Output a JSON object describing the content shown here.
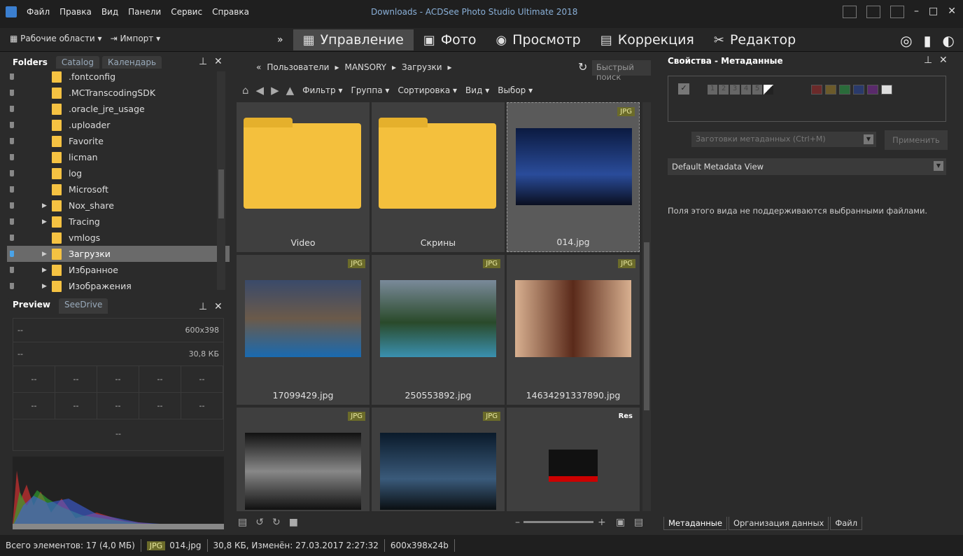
{
  "menu": [
    "Файл",
    "Правка",
    "Вид",
    "Панели",
    "Сервис",
    "Справка"
  ],
  "window_title": "Downloads - ACDSee Photo Studio Ultimate 2018",
  "modebar": {
    "workspaces": "Рабочие области",
    "import": "Импорт",
    "modes": [
      "Управление",
      "Фото",
      "Просмотр",
      "Коррекция",
      "Редактор"
    ],
    "active_mode": "Управление"
  },
  "left_tabs": [
    "Folders",
    "Catalog",
    "Календарь"
  ],
  "folders": [
    {
      "name": ".fontconfig",
      "expand": false,
      "selected": false
    },
    {
      "name": ".MCTranscodingSDK",
      "expand": false,
      "selected": false
    },
    {
      "name": ".oracle_jre_usage",
      "expand": false,
      "selected": false
    },
    {
      "name": ".uploader",
      "expand": false,
      "selected": false
    },
    {
      "name": "Favorite",
      "expand": false,
      "selected": false
    },
    {
      "name": "licman",
      "expand": false,
      "selected": false
    },
    {
      "name": "log",
      "expand": false,
      "selected": false
    },
    {
      "name": "Microsoft",
      "expand": false,
      "selected": false
    },
    {
      "name": "Nox_share",
      "expand": true,
      "selected": false
    },
    {
      "name": "Tracing",
      "expand": true,
      "selected": false
    },
    {
      "name": "vmlogs",
      "expand": false,
      "selected": false
    },
    {
      "name": "Загрузки",
      "expand": true,
      "selected": true
    },
    {
      "name": "Избранное",
      "expand": true,
      "selected": false
    },
    {
      "name": "Изображения",
      "expand": true,
      "selected": false
    }
  ],
  "preview_tabs": [
    "Preview",
    "SeeDrive"
  ],
  "preview": {
    "row1_left": "--",
    "row1_right": "600x398",
    "row2_left": "--",
    "row2_right": "30,8 КБ",
    "grid1": [
      "--",
      "--",
      "--",
      "--",
      "--"
    ],
    "grid2": [
      "--",
      "--",
      "--",
      "--",
      "--"
    ],
    "bottom": "--"
  },
  "path": [
    "«",
    "Пользователи",
    "MANSORY",
    "Загрузки"
  ],
  "quick_search": "Быстрый поиск",
  "toolbar": [
    "Фильтр",
    "Группа",
    "Сортировка",
    "Вид",
    "Выбор"
  ],
  "files": [
    {
      "name": "Video",
      "badge": "",
      "kind": "folder"
    },
    {
      "name": "Скрины",
      "badge": "",
      "kind": "folder2"
    },
    {
      "name": "014.jpg",
      "badge": "JPG",
      "kind": "night",
      "selected": true
    },
    {
      "name": "17099429.jpg",
      "badge": "JPG",
      "kind": "coast"
    },
    {
      "name": "250553892.jpg",
      "badge": "JPG",
      "kind": "forest"
    },
    {
      "name": "14634291337890.jpg",
      "badge": "JPG",
      "kind": "portrait"
    },
    {
      "name": "",
      "badge": "JPG",
      "kind": "meme"
    },
    {
      "name": "",
      "badge": "JPG",
      "kind": "road"
    },
    {
      "name": "",
      "badge": "Res",
      "kind": "res"
    }
  ],
  "right": {
    "title": "Свойства - Метаданные",
    "preset": "Заготовки метаданных (Ctrl+M)",
    "apply": "Применить",
    "view": "Default Metadata View",
    "notice": "Поля этого вида не поддерживаются выбранными файлами.",
    "tabs": [
      "Метаданные",
      "Организация данных",
      "Файл"
    ]
  },
  "status": {
    "total": "Всего элементов: 17 (4,0 МБ)",
    "badge": "JPG",
    "file": "014.jpg",
    "info": "30,8 КБ, Изменён: 27.03.2017 2:27:32",
    "dims": "600x398x24b"
  }
}
